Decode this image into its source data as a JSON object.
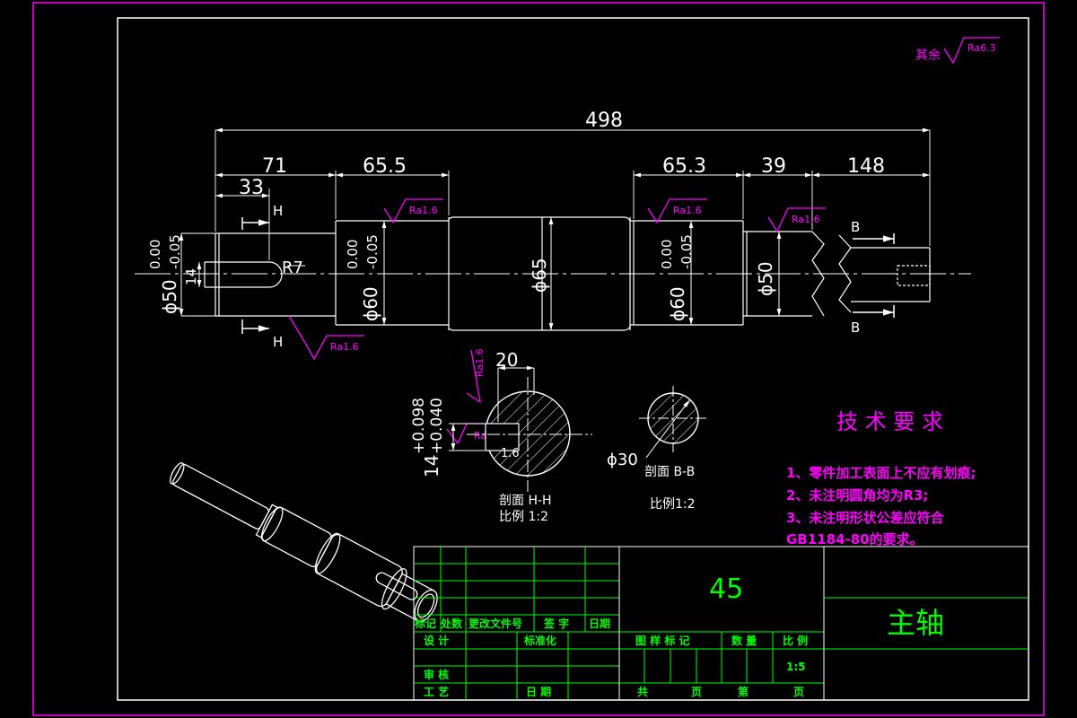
{
  "roughness": {
    "general_prefix": "其余",
    "general_value": "Ra6.3",
    "ra16": "Ra1.6"
  },
  "dimensions": {
    "overall": "498",
    "seg_71": "71",
    "seg_33": "33",
    "seg_655": "65.5",
    "seg_653": "65.3",
    "seg_39": "39",
    "seg_148": "148",
    "dia_50_left": "ϕ50",
    "dia_60_left": "ϕ60",
    "dia_65": "ϕ65",
    "dia_60_right": "ϕ60",
    "dia_50_right": "ϕ50",
    "tol_upper": "0.00",
    "tol_lower": "-0.05",
    "keyway_width": "14",
    "keyway_radius": "R7",
    "section_cut_H": "H",
    "section_cut_B": "B"
  },
  "section_hh": {
    "width_dim": "20",
    "depth_dim": "14",
    "tol_upper": "+0.098",
    "tol_lower": "+0.040",
    "depth_small": "1.6",
    "label": "剖面  H-H",
    "scale": "比例  1:2"
  },
  "section_bb": {
    "dia": "ϕ30",
    "label": "剖面  B-B",
    "scale": "比例1:2"
  },
  "tech_requirements": {
    "title": "技 术 要 求",
    "items": [
      "1、零件加工表面上不应有划痕;",
      "2、未注明圆角均为R3;",
      "3、未注明形状公差应符合",
      "GB1184-80的要求。"
    ]
  },
  "title_block": {
    "material": "45",
    "part_name": "主轴",
    "rev_headers": [
      "标记",
      "处数",
      "更改文件号",
      "签 字",
      "日期"
    ],
    "design": "设  计",
    "standardize": "标准化",
    "review": "审 核",
    "process": "工 艺",
    "date": "日 期",
    "col_drawing_mark": "图 样 标 记",
    "col_quantity": "数 量",
    "col_scale": "比 例",
    "scale_value": "1:5",
    "total_label": "共",
    "sheet_label": "页",
    "no_label": "第",
    "page_label": "页"
  },
  "colors": {
    "frame": "#ff00ff",
    "lines": "#ffffff",
    "title_block": "#00ff00",
    "roughness": "#ff00ff"
  }
}
